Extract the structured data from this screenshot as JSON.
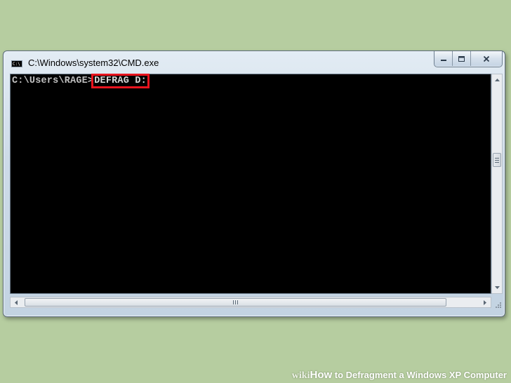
{
  "window": {
    "title": "C:\\Windows\\system32\\CMD.exe",
    "icon_text": "C:\\",
    "icon": "cmd-app-icon",
    "buttons": [
      "minimize-icon",
      "maximize-icon",
      "close-icon"
    ]
  },
  "console": {
    "prompt": "C:\\Users\\RAGE>",
    "command": "DEFRAG D:",
    "highlight_color": "#e8141e",
    "background": "#000000"
  },
  "watermark": {
    "wiki": "wiki",
    "how": "How",
    "text": " to Defragment a Windows XP Computer"
  },
  "colors": {
    "page_background": "#b6cda0"
  }
}
